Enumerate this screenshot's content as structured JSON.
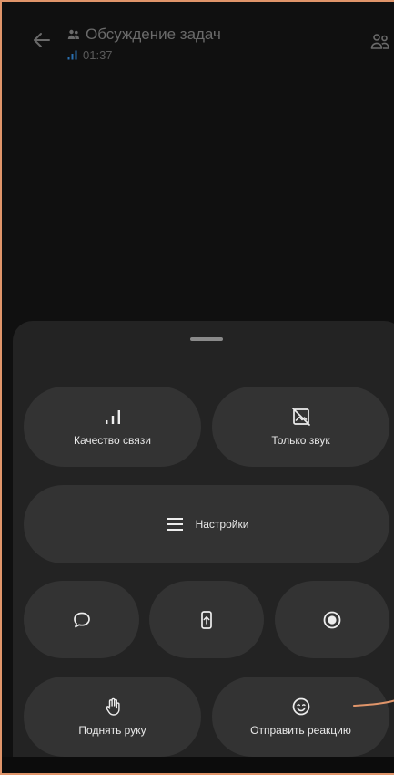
{
  "header": {
    "title": "Обсуждение задач",
    "timer": "01:37",
    "back_icon": "arrow-left-icon",
    "group_icon": "group-icon",
    "signal_icon": "signal-icon",
    "participants_icon": "participants-icon"
  },
  "sheet": {
    "quality_label": "Качество связи",
    "audio_only_label": "Только звук",
    "settings_label": "Настройки",
    "chat_icon": "chat-icon",
    "screen_share_icon": "screen-share-icon",
    "record_icon": "record-icon",
    "raise_hand_label": "Поднять руку",
    "reaction_label": "Отправить реакцию"
  },
  "colors": {
    "frame": "#e0956a",
    "sheet": "#232323",
    "button": "#333333",
    "accent_signal": "#2a6fb0"
  }
}
